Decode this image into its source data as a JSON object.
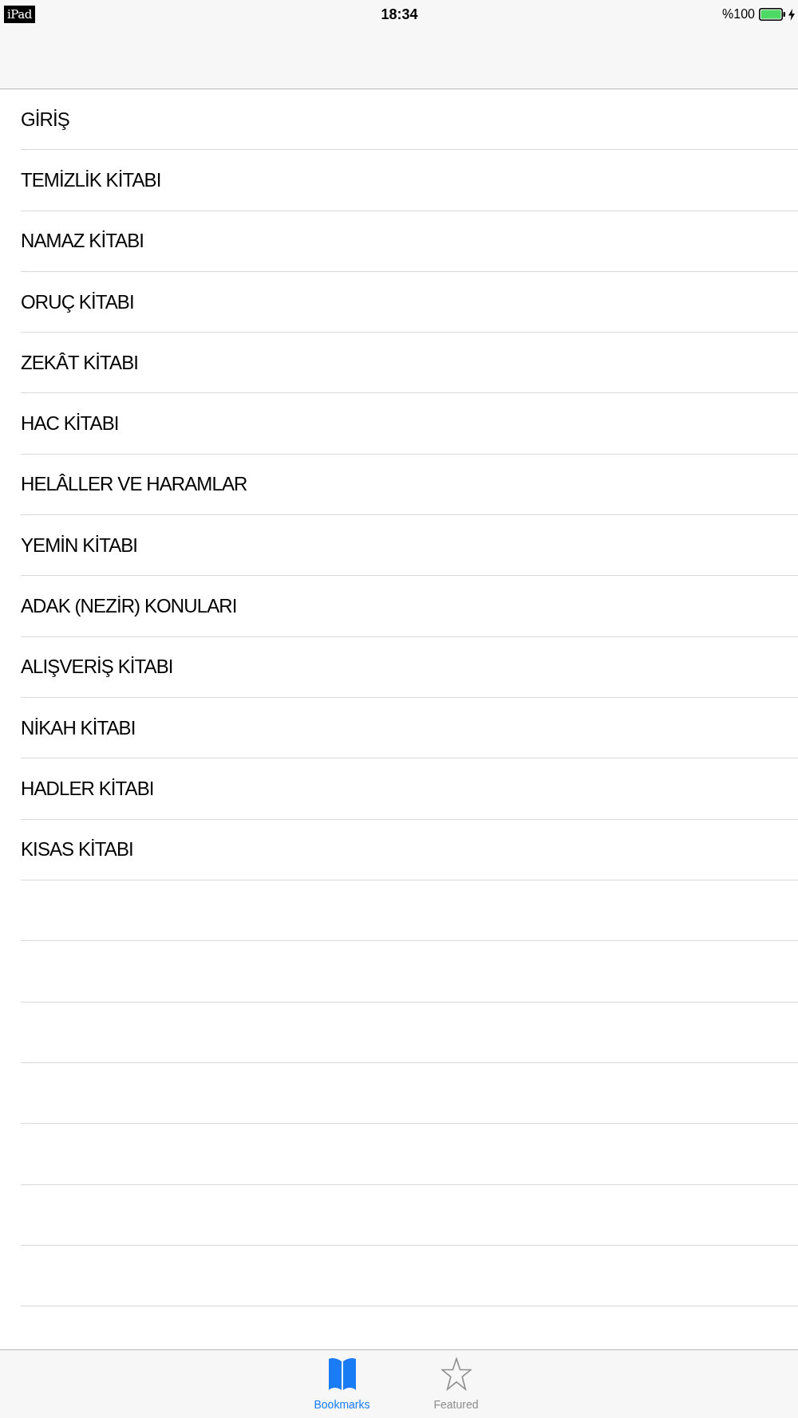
{
  "status_bar": {
    "device": "iPad",
    "time": "18:34",
    "battery": "%100"
  },
  "list": {
    "items": [
      {
        "title": "GİRİŞ"
      },
      {
        "title": "TEMİZLİK KİTABI"
      },
      {
        "title": "NAMAZ KİTABI"
      },
      {
        "title": "ORUÇ KİTABI"
      },
      {
        "title": "ZEKÂT KİTABI"
      },
      {
        "title": "HAC KİTABI"
      },
      {
        "title": "HELÂLLER VE HARAMLAR"
      },
      {
        "title": "YEMİN KİTABI"
      },
      {
        "title": "ADAK (NEZİR) KONULARI"
      },
      {
        "title": "ALIŞVERİŞ KİTABI"
      },
      {
        "title": "NİKAH KİTABI"
      },
      {
        "title": "HADLER KİTABI"
      },
      {
        "title": "KISAS KİTABI"
      }
    ]
  },
  "tab_bar": {
    "tabs": [
      {
        "label": "Bookmarks",
        "selected": true
      },
      {
        "label": "Featured",
        "selected": false
      }
    ]
  }
}
